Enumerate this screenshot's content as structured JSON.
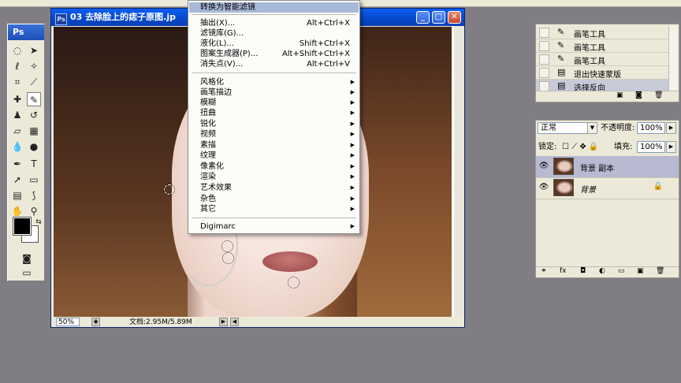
{
  "toolbox": {
    "logo": "Ps"
  },
  "document": {
    "title": "03 去除脸上的痣子原图.jp",
    "ps_badge": "Ps",
    "zoom": "50%",
    "doc_size": "文档:2.95M/5.89M"
  },
  "filter_menu": {
    "items": [
      {
        "label": "转换为智能滤镜",
        "shortcut": "",
        "submenu": false,
        "highlighted": true
      },
      {
        "label": "抽出(X)...",
        "shortcut": "Alt+Ctrl+X",
        "submenu": false
      },
      {
        "label": "滤镜库(G)...",
        "shortcut": "",
        "submenu": false
      },
      {
        "label": "液化(L)...",
        "shortcut": "Shift+Ctrl+X",
        "submenu": false
      },
      {
        "label": "图案生成器(P)...",
        "shortcut": "Alt+Shift+Ctrl+X",
        "submenu": false
      },
      {
        "label": "消失点(V)...",
        "shortcut": "Alt+Ctrl+V",
        "submenu": false
      },
      {
        "label": "风格化",
        "submenu": true
      },
      {
        "label": "画笔描边",
        "submenu": true
      },
      {
        "label": "模糊",
        "submenu": true
      },
      {
        "label": "扭曲",
        "submenu": true
      },
      {
        "label": "锐化",
        "submenu": true
      },
      {
        "label": "视频",
        "submenu": true
      },
      {
        "label": "素描",
        "submenu": true
      },
      {
        "label": "纹理",
        "submenu": true
      },
      {
        "label": "像素化",
        "submenu": true
      },
      {
        "label": "渲染",
        "submenu": true
      },
      {
        "label": "艺术效果",
        "submenu": true
      },
      {
        "label": "杂色",
        "submenu": true
      },
      {
        "label": "其它",
        "submenu": true
      },
      {
        "label": "Digimarc",
        "submenu": true
      }
    ]
  },
  "history": {
    "items": [
      {
        "label": "画笔工具",
        "icon": "brush-icon"
      },
      {
        "label": "画笔工具",
        "icon": "brush-icon"
      },
      {
        "label": "画笔工具",
        "icon": "brush-icon"
      },
      {
        "label": "退出快速蒙版",
        "icon": "document-icon"
      },
      {
        "label": "选择反向",
        "icon": "document-icon",
        "selected": true
      }
    ]
  },
  "layers": {
    "blend_mode": "正常",
    "opacity_label": "不透明度:",
    "opacity": "100%",
    "lock_label": "锁定:",
    "fill_label": "填充:",
    "fill": "100%",
    "items": [
      {
        "name": "背景 副本",
        "selected": true,
        "locked": false
      },
      {
        "name": "背景",
        "selected": false,
        "locked": true
      }
    ]
  },
  "colors": {
    "accent": "#0a5ef2",
    "menu_highlight": "#a8b8d8",
    "selected_layer": "#b7bad0"
  }
}
